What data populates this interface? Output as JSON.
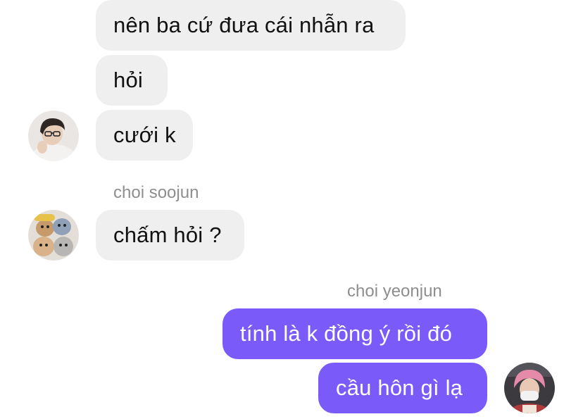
{
  "messages": {
    "m1": "nên ba cứ đưa cái nhẫn ra",
    "m2": "hỏi",
    "m3": "cưới k",
    "soojun_name": "choi soojun",
    "m4": "chấm hỏi ?",
    "yeonjun_name": "choi yeonjun",
    "m5": "tính là k đồng ý rồi đó",
    "m6": "cầu hôn gì lạ"
  },
  "colors": {
    "incoming_bubble": "#efefef",
    "outgoing_bubble": "#7a5af8",
    "sender_name": "#8e8e8e"
  },
  "icons": {
    "avatar_1": "person-glasses-avatar",
    "avatar_2": "plush-toys-avatar",
    "avatar_3": "masked-person-avatar"
  }
}
